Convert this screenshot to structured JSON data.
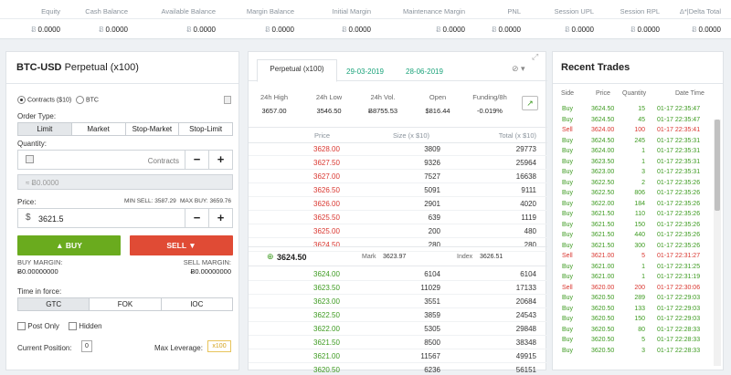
{
  "topbar": {
    "headers": [
      "Equity",
      "Cash Balance",
      "Available Balance",
      "Margin Balance",
      "Initial Margin",
      "Maintenance Margin",
      "PNL",
      "Session UPL",
      "Session RPL",
      "Δ*|Delta Total"
    ],
    "values": [
      "0.0000",
      "0.0000",
      "0.0000",
      "0.0000",
      "0.0000",
      "0.0000",
      "0.0000",
      "0.0000",
      "0.0000",
      "0.0000"
    ],
    "currency_symbol": "Ƀ"
  },
  "order": {
    "title_main": "BTC-USD",
    "title_sub": "Perpetual (x100)",
    "radio_contracts": "Contracts ($10)",
    "radio_btc": "BTC",
    "order_type_label": "Order Type:",
    "order_types": [
      "Limit",
      "Market",
      "Stop-Market",
      "Stop-Limit"
    ],
    "quantity_label": "Quantity:",
    "quantity_unit": "Contracts",
    "btc_equiv": "≈ Ƀ0.0000",
    "price_label": "Price:",
    "min_sell": "MIN SELL: 3587.29",
    "max_buy": "MAX BUY: 3659.76",
    "price_currency": "$",
    "price_value": "3621.5",
    "minus": "−",
    "plus": "+",
    "buy_label": "BUY",
    "sell_label": "SELL",
    "buy_margin_label": "BUY MARGIN:",
    "buy_margin_value": "Ƀ0.00000000",
    "sell_margin_label": "SELL MARGIN:",
    "sell_margin_value": "Ƀ0.00000000",
    "tif_label": "Time in force:",
    "tif_options": [
      "GTC",
      "FOK",
      "IOC"
    ],
    "post_only": "Post Only",
    "hidden": "Hidden",
    "current_position_label": "Current Position:",
    "current_position_value": "0",
    "max_leverage_label": "Max Leverage:",
    "max_leverage_value": "x100"
  },
  "book": {
    "tabs": [
      "Perpetual (x100)",
      "29-03-2019",
      "28-06-2019"
    ],
    "stats": [
      {
        "label": "24h High",
        "value": "3657.00"
      },
      {
        "label": "24h Low",
        "value": "3546.50"
      },
      {
        "label": "24h Vol.",
        "value": "Ƀ8755.53"
      },
      {
        "label": "Open",
        "value": "$816.44"
      },
      {
        "label": "Funding/8h",
        "value": "-0.019%"
      }
    ],
    "col_price": "Price",
    "col_size": "Size (x $10)",
    "col_total": "Total (x $10)",
    "asks": [
      {
        "price": "3628.00",
        "size": "3809",
        "total": "29773"
      },
      {
        "price": "3627.50",
        "size": "9326",
        "total": "25964"
      },
      {
        "price": "3627.00",
        "size": "7527",
        "total": "16638"
      },
      {
        "price": "3626.50",
        "size": "5091",
        "total": "9111"
      },
      {
        "price": "3626.00",
        "size": "2901",
        "total": "4020"
      },
      {
        "price": "3625.50",
        "size": "639",
        "total": "1119"
      },
      {
        "price": "3625.00",
        "size": "200",
        "total": "480"
      },
      {
        "price": "3624.50",
        "size": "280",
        "total": "280"
      }
    ],
    "last_price": "3624.50",
    "mark_label": "Mark",
    "mark_value": "3623.97",
    "index_label": "Index",
    "index_value": "3626.51",
    "bids": [
      {
        "price": "3624.00",
        "size": "6104",
        "total": "6104"
      },
      {
        "price": "3623.50",
        "size": "11029",
        "total": "17133"
      },
      {
        "price": "3623.00",
        "size": "3551",
        "total": "20684"
      },
      {
        "price": "3622.50",
        "size": "3859",
        "total": "24543"
      },
      {
        "price": "3622.00",
        "size": "5305",
        "total": "29848"
      },
      {
        "price": "3621.50",
        "size": "8500",
        "total": "38348"
      },
      {
        "price": "3621.00",
        "size": "11567",
        "total": "49915"
      },
      {
        "price": "3620.50",
        "size": "6236",
        "total": "56151"
      }
    ]
  },
  "trades": {
    "title": "Recent Trades",
    "headers": [
      "Side",
      "Price",
      "Quantity",
      "Date Time"
    ],
    "rows": [
      {
        "side": "Buy",
        "price": "3624.50",
        "qty": "15",
        "time": "01-17 22:35:47"
      },
      {
        "side": "Buy",
        "price": "3624.50",
        "qty": "45",
        "time": "01-17 22:35:47"
      },
      {
        "side": "Sell",
        "price": "3624.00",
        "qty": "100",
        "time": "01-17 22:35:41"
      },
      {
        "side": "Buy",
        "price": "3624.50",
        "qty": "245",
        "time": "01-17 22:35:31"
      },
      {
        "side": "Buy",
        "price": "3624.00",
        "qty": "1",
        "time": "01-17 22:35:31"
      },
      {
        "side": "Buy",
        "price": "3623.50",
        "qty": "1",
        "time": "01-17 22:35:31"
      },
      {
        "side": "Buy",
        "price": "3623.00",
        "qty": "3",
        "time": "01-17 22:35:31"
      },
      {
        "side": "Buy",
        "price": "3622.50",
        "qty": "2",
        "time": "01-17 22:35:26"
      },
      {
        "side": "Buy",
        "price": "3622.50",
        "qty": "806",
        "time": "01-17 22:35:26"
      },
      {
        "side": "Buy",
        "price": "3622.00",
        "qty": "184",
        "time": "01-17 22:35:26"
      },
      {
        "side": "Buy",
        "price": "3621.50",
        "qty": "110",
        "time": "01-17 22:35:26"
      },
      {
        "side": "Buy",
        "price": "3621.50",
        "qty": "150",
        "time": "01-17 22:35:26"
      },
      {
        "side": "Buy",
        "price": "3621.50",
        "qty": "440",
        "time": "01-17 22:35:26"
      },
      {
        "side": "Buy",
        "price": "3621.50",
        "qty": "300",
        "time": "01-17 22:35:26"
      },
      {
        "side": "Sell",
        "price": "3621.00",
        "qty": "5",
        "time": "01-17 22:31:27"
      },
      {
        "side": "Buy",
        "price": "3621.00",
        "qty": "1",
        "time": "01-17 22:31:25"
      },
      {
        "side": "Buy",
        "price": "3621.00",
        "qty": "1",
        "time": "01-17 22:31:19"
      },
      {
        "side": "Sell",
        "price": "3620.00",
        "qty": "200",
        "time": "01-17 22:30:06"
      },
      {
        "side": "Buy",
        "price": "3620.50",
        "qty": "289",
        "time": "01-17 22:29:03"
      },
      {
        "side": "Buy",
        "price": "3620.50",
        "qty": "133",
        "time": "01-17 22:29:03"
      },
      {
        "side": "Buy",
        "price": "3620.50",
        "qty": "150",
        "time": "01-17 22:29:03"
      },
      {
        "side": "Buy",
        "price": "3620.50",
        "qty": "80",
        "time": "01-17 22:28:33"
      },
      {
        "side": "Buy",
        "price": "3620.50",
        "qty": "5",
        "time": "01-17 22:28:33"
      },
      {
        "side": "Buy",
        "price": "3620.50",
        "qty": "3",
        "time": "01-17 22:28:33"
      }
    ]
  },
  "colors": {
    "buy": "#6aab1e",
    "sell": "#e04b35",
    "green_text": "#3c9a1f",
    "red_text": "#d9362f",
    "accent": "#1aa37a"
  }
}
